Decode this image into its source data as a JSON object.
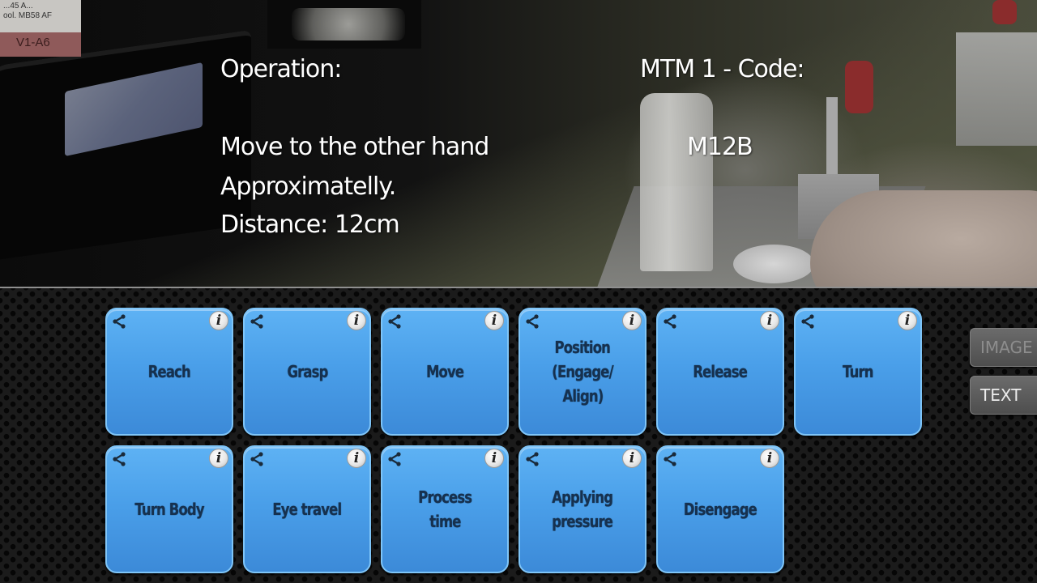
{
  "video": {
    "operation_label": "Operation:",
    "operation_lines": [
      "Move to the other hand",
      "Approximatelly.",
      "Distance: 12cm"
    ],
    "code_label": "MTM 1 - Code:",
    "code_value": "M12B",
    "background_labels": {
      "bin_label_text": "...45 A...\nool. MB58 AF",
      "bin_label_code": "V1-A6"
    }
  },
  "tiles": [
    {
      "label_lines": [
        "Reach"
      ],
      "share_icon": "share-icon",
      "info_icon": "info-icon"
    },
    {
      "label_lines": [
        "Grasp"
      ],
      "share_icon": "share-icon",
      "info_icon": "info-icon"
    },
    {
      "label_lines": [
        "Move"
      ],
      "share_icon": "share-icon",
      "info_icon": "info-icon"
    },
    {
      "label_lines": [
        "Position",
        "(Engage/",
        "Align)"
      ],
      "share_icon": "share-icon",
      "info_icon": "info-icon"
    },
    {
      "label_lines": [
        "Release"
      ],
      "share_icon": "share-icon",
      "info_icon": "info-icon"
    },
    {
      "label_lines": [
        "Turn"
      ],
      "share_icon": "share-icon",
      "info_icon": "info-icon"
    },
    {
      "label_lines": [
        "Turn Body"
      ],
      "share_icon": "share-icon",
      "info_icon": "info-icon"
    },
    {
      "label_lines": [
        "Eye travel"
      ],
      "share_icon": "share-icon",
      "info_icon": "info-icon"
    },
    {
      "label_lines": [
        "Process",
        "time"
      ],
      "share_icon": "share-icon",
      "info_icon": "info-icon"
    },
    {
      "label_lines": [
        "Applying",
        "pressure"
      ],
      "share_icon": "share-icon",
      "info_icon": "info-icon"
    },
    {
      "label_lines": [
        "Disengage"
      ],
      "share_icon": "share-icon",
      "info_icon": "info-icon"
    }
  ],
  "info_glyph": "i",
  "side_buttons": {
    "image_label": "IMAGE",
    "image_state": "disabled",
    "text_label": "TEXT",
    "text_state": "active"
  },
  "colors": {
    "tile_blue": "#4a9fe9",
    "tile_text": "#16314f",
    "panel_bg": "#1b1b1b"
  }
}
